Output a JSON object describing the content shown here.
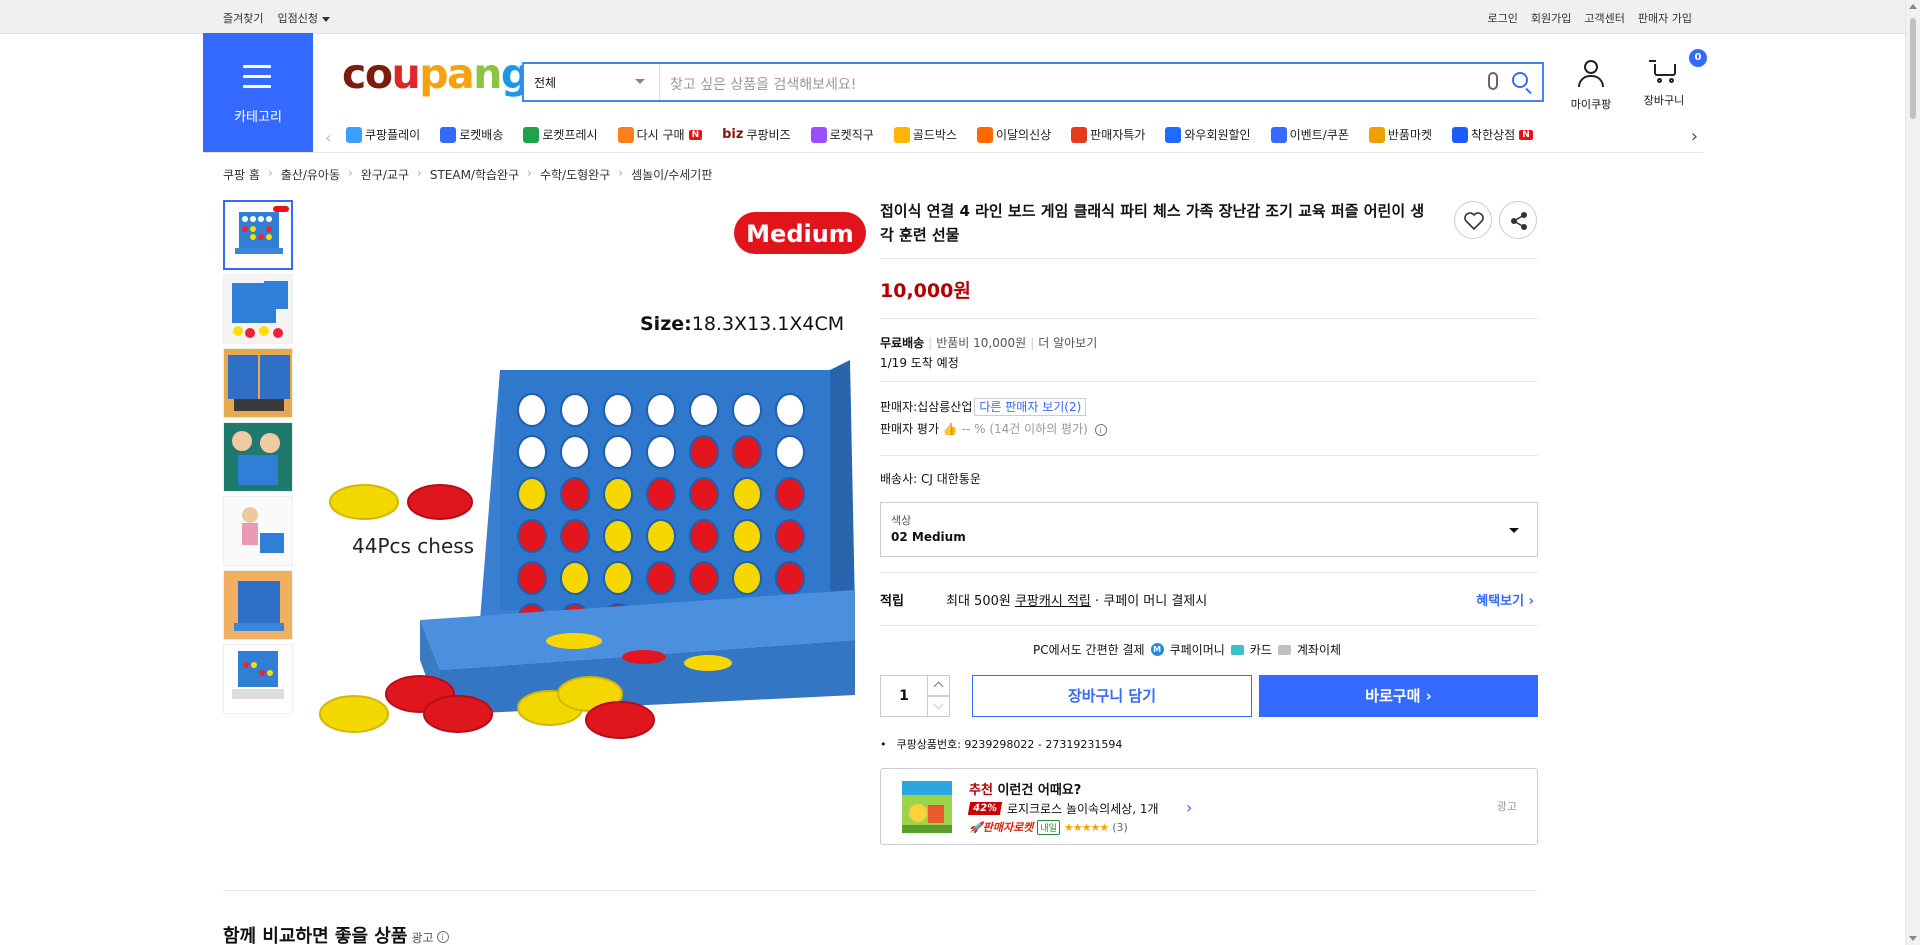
{
  "util_bar": {
    "left": [
      "즐겨찾기",
      "입점신청"
    ],
    "right": [
      "로그인",
      "회원가입",
      "고객센터",
      "판매자 가입"
    ]
  },
  "header": {
    "category_label": "카테고리",
    "logo": [
      "c",
      "o",
      "u",
      "p",
      "a",
      "n",
      "g"
    ],
    "search": {
      "category": "전체",
      "placeholder": "찾고 싶은 상품을 검색해보세요!"
    },
    "mycoupang_label": "마이쿠팡",
    "cart_label": "장바구니",
    "cart_count": "0"
  },
  "nav": {
    "items": [
      {
        "label": "쿠팡플레이",
        "icon": "play-icon",
        "color": "#3aa0ff"
      },
      {
        "label": "로켓배송",
        "icon": "rocket-icon",
        "color": "#346aff"
      },
      {
        "label": "로켓프레시",
        "icon": "rocket-fresh-icon",
        "color": "#1ea24a"
      },
      {
        "label": "다시 구매",
        "icon": "rebuy-icon",
        "color": "#ff7f1e",
        "badge": "N"
      },
      {
        "label": "쿠팡비즈",
        "icon": "biz-icon",
        "color": "#ffffff",
        "prefix": "biz"
      },
      {
        "label": "로켓직구",
        "icon": "global-icon",
        "color": "#9b4dff"
      },
      {
        "label": "골드박스",
        "icon": "goldbox-icon",
        "color": "#ffb400"
      },
      {
        "label": "이달의신상",
        "icon": "new-icon",
        "color": "#ff6a00"
      },
      {
        "label": "판매자특가",
        "icon": "percent-icon",
        "color": "#e63a1e"
      },
      {
        "label": "와우회원할인",
        "icon": "wow-icon",
        "color": "#1e6bff"
      },
      {
        "label": "이벤트/쿠폰",
        "icon": "coupon-icon",
        "color": "#346aff"
      },
      {
        "label": "반품마켓",
        "icon": "return-icon",
        "color": "#f0a000"
      },
      {
        "label": "착한상점",
        "icon": "shop-icon",
        "color": "#1e5bff",
        "badge": "N"
      }
    ]
  },
  "breadcrumb": [
    "쿠팡 홈",
    "출산/유아동",
    "완구/교구",
    "STEAM/학습완구",
    "수학/도형완구",
    "셈놀이/수세기판"
  ],
  "product": {
    "image_text": {
      "badge": "Medium",
      "size_prefix": "Size:",
      "size_value": "18.3X13.1X4CM",
      "chess": "44Pcs chess"
    },
    "title": "접이식 연결 4 라인 보드 게임 클래식 파티 체스 가족 장난감 조기 교육 퍼즐 어린이 생각 훈련 선물",
    "price": "10,000원",
    "shipping": {
      "free": "무료배송",
      "return": "반품비 10,000원",
      "more": "더 알아보기",
      "eta": "1/19 도착 예정"
    },
    "seller": {
      "label": "판매자:",
      "name": "십삼릉산업",
      "other": "다른 판매자 보기(2)",
      "rating_label": "판매자 평가",
      "rating_value": "-- % (14건 이하의 평가)"
    },
    "carrier": "배송사:  CJ 대한통운",
    "option": {
      "label": "색상",
      "value": "02 Medium"
    },
    "reward": {
      "title": "적립",
      "prefix": "최대 500원 ",
      "cash": "쿠팡캐시 적립",
      "suffix": " · 쿠페이 머니 결제시",
      "more": "혜택보기"
    },
    "pc_pay": {
      "label": "PC에서도 간편한 결제",
      "coupay": "쿠페이머니",
      "card": "카드",
      "bank": "계좌이체"
    },
    "quantity": "1",
    "cart_button": "장바구니 담기",
    "buy_button": "바로구매",
    "product_no": "쿠팡상품번호: 9239298022 - 27319231594"
  },
  "recommendation": {
    "highlight": "추천",
    "title": "이런건 어때요?",
    "discount": "42%",
    "name": "로지크로스 놀이속의세상, 1개",
    "rocket": "판매자로켓",
    "tomorrow": "내일",
    "stars": "★★★★★",
    "count": "(3)",
    "ad": "광고"
  },
  "compare": {
    "title": "함께 비교하면 좋을 상품",
    "ad": "광고"
  },
  "colors": {
    "accent": "#346aff",
    "price": "#ae0000"
  }
}
